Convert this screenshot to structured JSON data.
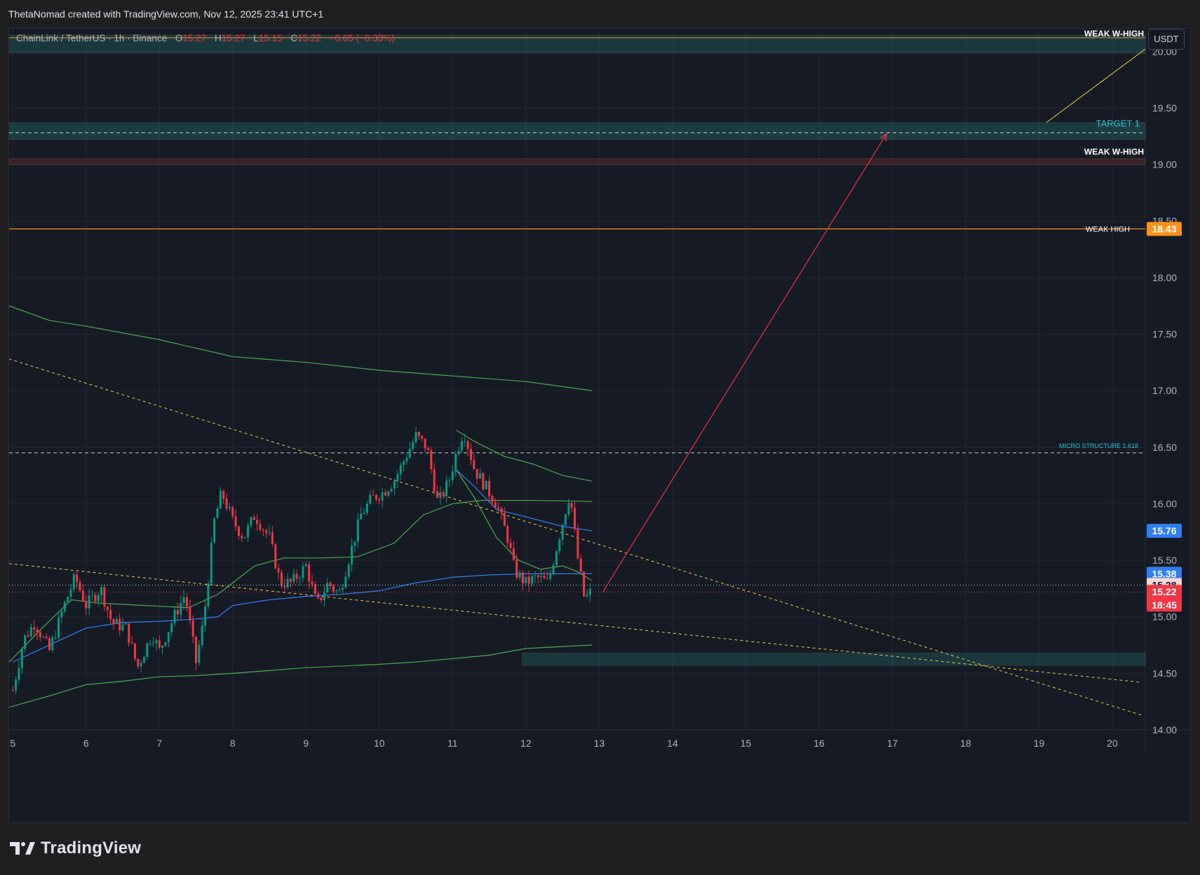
{
  "header": {
    "attribution": "ThetaNomad created with TradingView.com, Nov 12, 2025 23:41 UTC+1"
  },
  "legend": {
    "symbol": "ChainLink / TetherUS · 1h · Binance",
    "open_label": "O",
    "open": "15.27",
    "high_label": "H",
    "high": "15.27",
    "low_label": "L",
    "low": "15.15",
    "close_label": "C",
    "close": "15.22",
    "change": "−0.05 (−0.33%)"
  },
  "currency_button": "USDT",
  "footer": {
    "brand": "TradingView"
  },
  "colors": {
    "background": "#161a25",
    "up": "#089981",
    "down": "#f23645",
    "ema_blue": "#2f7ff2",
    "envelope_green": "#4caf50",
    "weak_high": "#f7931a",
    "target": "#26c6da",
    "trendline": "#f5d547",
    "projection": "#f23645"
  },
  "chart_data": {
    "type": "candlestick",
    "symbol": "LINKUSDT",
    "interval": "1h",
    "exchange": "Binance",
    "xlim": [
      4.95,
      20.45
    ],
    "ylim": [
      14.0,
      20.2
    ],
    "x_ticks": [
      5,
      6,
      7,
      8,
      9,
      10,
      11,
      12,
      13,
      14,
      15,
      16,
      17,
      18,
      19,
      20
    ],
    "y_ticks": [
      "14.00",
      "14.50",
      "15.00",
      "15.50",
      "16.00",
      "16.50",
      "17.00",
      "17.50",
      "18.00",
      "18.50",
      "19.00",
      "19.50",
      "20.00"
    ],
    "close_path": [
      [
        5.0,
        14.35
      ],
      [
        5.15,
        14.8
      ],
      [
        5.3,
        14.95
      ],
      [
        5.5,
        14.7
      ],
      [
        5.7,
        15.1
      ],
      [
        5.85,
        15.35
      ],
      [
        6.0,
        15.1
      ],
      [
        6.2,
        15.25
      ],
      [
        6.35,
        14.95
      ],
      [
        6.55,
        14.9
      ],
      [
        6.7,
        14.55
      ],
      [
        6.9,
        14.85
      ],
      [
        7.0,
        14.7
      ],
      [
        7.2,
        15.0
      ],
      [
        7.35,
        15.2
      ],
      [
        7.5,
        14.6
      ],
      [
        7.6,
        14.95
      ],
      [
        7.75,
        15.85
      ],
      [
        7.85,
        16.1
      ],
      [
        8.0,
        15.85
      ],
      [
        8.15,
        15.7
      ],
      [
        8.3,
        15.9
      ],
      [
        8.5,
        15.7
      ],
      [
        8.65,
        15.3
      ],
      [
        8.8,
        15.3
      ],
      [
        9.0,
        15.45
      ],
      [
        9.15,
        15.1
      ],
      [
        9.3,
        15.3
      ],
      [
        9.45,
        15.2
      ],
      [
        9.6,
        15.55
      ],
      [
        9.75,
        15.9
      ],
      [
        9.9,
        16.05
      ],
      [
        10.05,
        16.1
      ],
      [
        10.2,
        16.2
      ],
      [
        10.35,
        16.4
      ],
      [
        10.5,
        16.6
      ],
      [
        10.65,
        16.5
      ],
      [
        10.8,
        16.0
      ],
      [
        10.95,
        16.2
      ],
      [
        11.05,
        16.45
      ],
      [
        11.15,
        16.65
      ],
      [
        11.3,
        16.3
      ],
      [
        11.45,
        16.15
      ],
      [
        11.6,
        16.0
      ],
      [
        11.75,
        15.7
      ],
      [
        11.85,
        15.4
      ],
      [
        12.0,
        15.3
      ],
      [
        12.15,
        15.35
      ],
      [
        12.3,
        15.3
      ],
      [
        12.45,
        15.7
      ],
      [
        12.6,
        16.1
      ],
      [
        12.7,
        15.55
      ],
      [
        12.8,
        15.15
      ],
      [
        12.88,
        15.22
      ]
    ],
    "indicators": {
      "ema_blue": {
        "last": "15.38",
        "points": [
          [
            5.0,
            14.6
          ],
          [
            5.5,
            14.75
          ],
          [
            6.0,
            14.9
          ],
          [
            6.5,
            14.95
          ],
          [
            7.0,
            14.96
          ],
          [
            7.5,
            14.98
          ],
          [
            7.8,
            15.0
          ],
          [
            8.0,
            15.1
          ],
          [
            8.5,
            15.15
          ],
          [
            9.0,
            15.18
          ],
          [
            9.5,
            15.2
          ],
          [
            10.0,
            15.23
          ],
          [
            10.5,
            15.3
          ],
          [
            11.0,
            15.35
          ],
          [
            11.5,
            15.37
          ],
          [
            12.0,
            15.38
          ],
          [
            12.5,
            15.38
          ],
          [
            12.9,
            15.38
          ]
        ]
      },
      "ema_blue_fast": {
        "last": "15.76",
        "points": [
          [
            11.05,
            16.3
          ],
          [
            11.3,
            16.15
          ],
          [
            11.6,
            15.95
          ],
          [
            11.9,
            15.9
          ],
          [
            12.2,
            15.85
          ],
          [
            12.5,
            15.8
          ],
          [
            12.7,
            15.78
          ],
          [
            12.9,
            15.76
          ]
        ]
      },
      "green_upper": {
        "points": [
          [
            4.95,
            17.75
          ],
          [
            5.5,
            17.62
          ],
          [
            6.0,
            17.57
          ],
          [
            7.0,
            17.45
          ],
          [
            8.0,
            17.3
          ],
          [
            9.0,
            17.25
          ],
          [
            10.0,
            17.18
          ],
          [
            11.0,
            17.13
          ],
          [
            12.0,
            17.08
          ],
          [
            12.9,
            17.0
          ]
        ]
      },
      "green_lower": {
        "points": [
          [
            4.95,
            14.2
          ],
          [
            5.5,
            14.3
          ],
          [
            6.0,
            14.4
          ],
          [
            6.5,
            14.43
          ],
          [
            7.0,
            14.47
          ],
          [
            7.5,
            14.48
          ],
          [
            8.0,
            14.5
          ],
          [
            9.0,
            14.55
          ],
          [
            10.0,
            14.58
          ],
          [
            10.5,
            14.6
          ],
          [
            11.0,
            14.63
          ],
          [
            11.5,
            14.66
          ],
          [
            12.0,
            14.72
          ],
          [
            12.9,
            14.75
          ]
        ]
      },
      "green_mid": {
        "points": [
          [
            4.95,
            14.6
          ],
          [
            5.4,
            14.9
          ],
          [
            5.8,
            15.15
          ],
          [
            6.2,
            15.12
          ],
          [
            6.8,
            15.1
          ],
          [
            7.4,
            15.08
          ],
          [
            7.8,
            15.2
          ],
          [
            8.3,
            15.45
          ],
          [
            8.7,
            15.52
          ],
          [
            9.2,
            15.52
          ],
          [
            9.7,
            15.53
          ],
          [
            10.2,
            15.65
          ],
          [
            10.6,
            15.9
          ],
          [
            11.0,
            16.0
          ],
          [
            11.4,
            16.03
          ],
          [
            12.0,
            16.03
          ],
          [
            12.9,
            16.02
          ]
        ]
      },
      "green_upper_band": {
        "points": [
          [
            11.05,
            16.65
          ],
          [
            11.3,
            16.55
          ],
          [
            11.7,
            16.42
          ],
          [
            12.1,
            16.35
          ],
          [
            12.5,
            16.25
          ],
          [
            12.9,
            16.2
          ]
        ]
      },
      "green_lower_band": {
        "points": [
          [
            11.05,
            16.3
          ],
          [
            11.3,
            16.05
          ],
          [
            11.6,
            15.7
          ],
          [
            11.9,
            15.5
          ],
          [
            12.2,
            15.42
          ],
          [
            12.5,
            15.45
          ],
          [
            12.7,
            15.4
          ],
          [
            12.9,
            15.32
          ]
        ]
      }
    },
    "levels": [
      {
        "label": "WEAK W-HIGH",
        "price": 20.12
      },
      {
        "label": "TARGET 1",
        "price": 19.28,
        "zone": [
          19.22,
          19.37
        ]
      },
      {
        "label": "WEAK W-HIGH",
        "price": 19.03
      },
      {
        "label": "WEAK HIGH",
        "price": 18.43,
        "badge": "18.43"
      },
      {
        "label": "MICRO STRUCTURE 1.618",
        "price": 16.45
      }
    ],
    "demand_zone": {
      "x": [
        11.95,
        20.45
      ],
      "y": [
        14.57,
        14.68
      ]
    },
    "trendlines": [
      {
        "from": [
          4.95,
          17.28
        ],
        "to": [
          20.4,
          14.13
        ]
      },
      {
        "from": [
          4.95,
          15.47
        ],
        "to": [
          20.4,
          14.42
        ]
      }
    ],
    "projection_arrow": {
      "from": [
        13.05,
        15.22
      ],
      "to": [
        16.92,
        19.27
      ]
    },
    "price_labels": {
      "ema_fast": "15.76",
      "ema_slow": "15.38",
      "previous_close": "15.28",
      "last_price": "15.22",
      "countdown": "18:45"
    }
  }
}
